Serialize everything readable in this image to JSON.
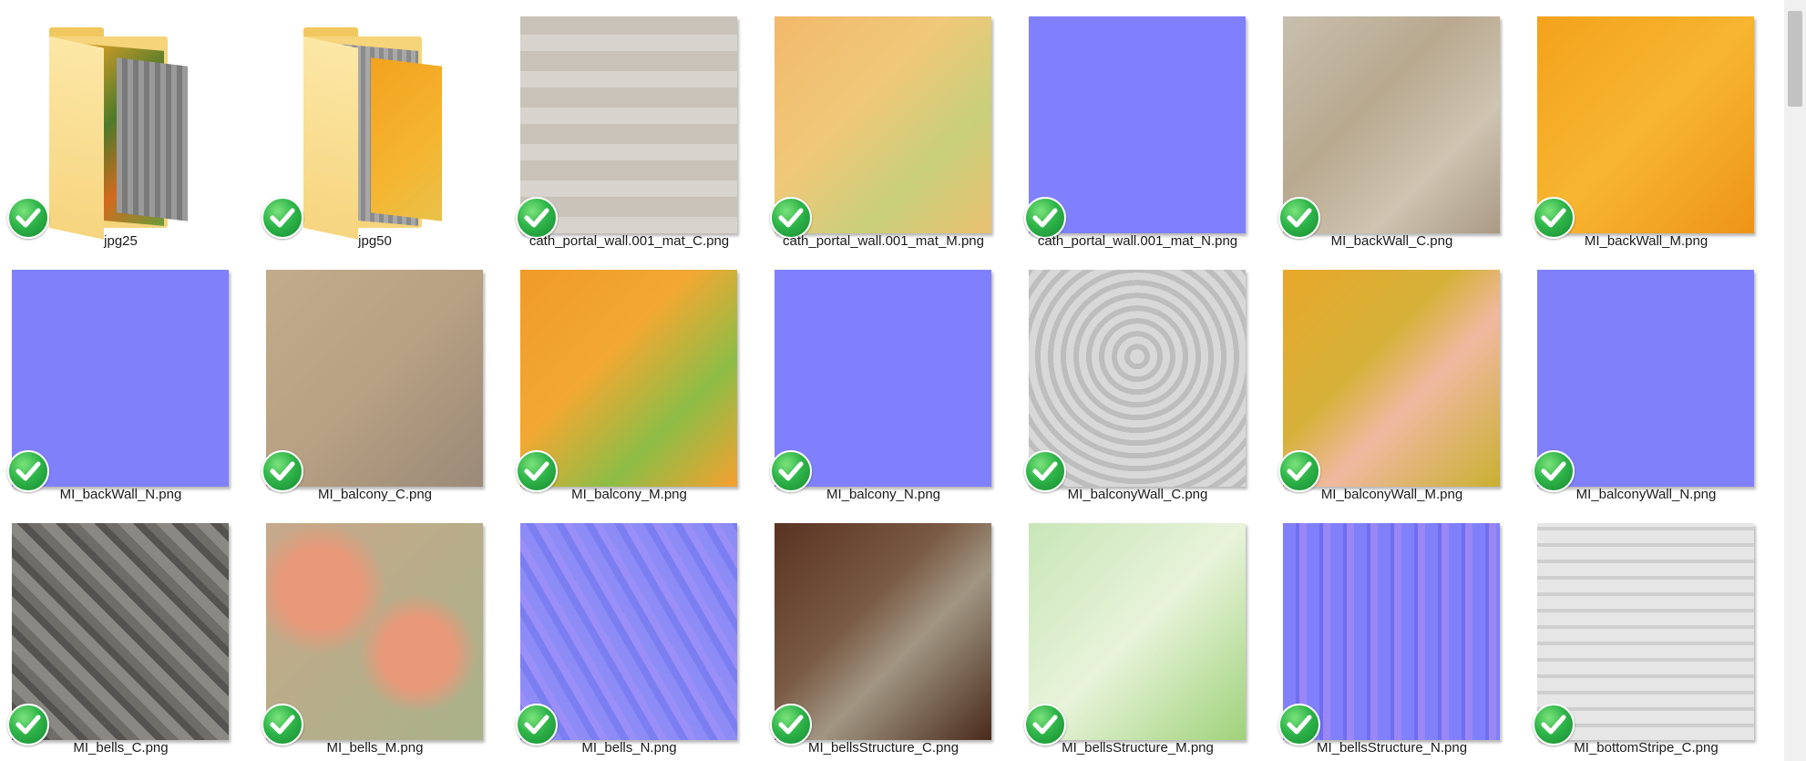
{
  "items": [
    {
      "name": "jpg25",
      "kind": "folder",
      "papers": [
        "linear-gradient(135deg,#e0a028,#4d7a2a 40%,#d26a1e 70%,#6a9b3a)",
        "repeating-linear-gradient(90deg,#9a9a9a 0 6px,#7a7a7a 6px 12px)"
      ]
    },
    {
      "name": "jpg50",
      "kind": "folder",
      "papers": [
        "repeating-linear-gradient(90deg,#a8a8a8 0 5px,#8a8a8a 5px 10px)",
        "linear-gradient(135deg,#f2a21e,#f5b530 60%,#e8c14a)"
      ]
    },
    {
      "name": "cath_portal_wall.001_mat_C.png",
      "kind": "image",
      "bg": "repeating-linear-gradient(0deg,#d8d3cc 0 18px,#c9c2b9 18px 40px),linear-gradient(90deg,#d6d0c7,#bfb7ac)"
    },
    {
      "name": "cath_portal_wall.001_mat_M.png",
      "kind": "image",
      "bg": "linear-gradient(135deg,#f2b96a,#f0c879 40%,#c9cf7a 70%,#e8c070)"
    },
    {
      "name": "cath_portal_wall.001_mat_N.png",
      "kind": "image",
      "bg": "#8080fd"
    },
    {
      "name": "MI_backWall_C.png",
      "kind": "image",
      "bg": "linear-gradient(135deg,#c9bfae,#b8a98f 40%,#cfc4b1 70%,#a99a84)"
    },
    {
      "name": "MI_backWall_M.png",
      "kind": "image",
      "bg": "linear-gradient(135deg,#f4a21c,#f7b530 50%,#ee9418)"
    },
    {
      "name": "MI_backWall_N.png",
      "kind": "image",
      "bg": "#8080fb"
    },
    {
      "name": "MI_balcony_C.png",
      "kind": "image",
      "bg": "linear-gradient(135deg,#c2ab8c,#b8a083 50%,#9a8a78)"
    },
    {
      "name": "MI_balcony_M.png",
      "kind": "image",
      "bg": "linear-gradient(135deg,#f09a2a,#f2a832 40%,#8dbd46 70%,#f5a030)"
    },
    {
      "name": "MI_balcony_N.png",
      "kind": "image",
      "bg": "#8080fd"
    },
    {
      "name": "MI_balconyWall_C.png",
      "kind": "image",
      "bg": "repeating-radial-gradient(circle at 50% 40%,#d8d8d8 0 8px,#bdbdbd 8px 14px)"
    },
    {
      "name": "MI_balconyWall_M.png",
      "kind": "image",
      "bg": "linear-gradient(135deg,#e8a82a,#d6b13a 40%,#f0b8a0 60%,#c9b030)"
    },
    {
      "name": "MI_balconyWall_N.png",
      "kind": "image",
      "bg": "#8080fb"
    },
    {
      "name": "MI_bells_C.png",
      "kind": "image",
      "bg": "repeating-linear-gradient(45deg,#6f6d68 0 10px,#8a8882 10px 22px,#55534f 22px 30px)"
    },
    {
      "name": "MI_bells_M.png",
      "kind": "image",
      "bg": "radial-gradient(circle at 25% 30%,#e8997a 0 18%,transparent 30%),radial-gradient(circle at 70% 60%,#e8997a 0 18%,transparent 30%),linear-gradient(135deg,#c7a88a,#a9b28a)"
    },
    {
      "name": "MI_bells_N.png",
      "kind": "image",
      "bg": "repeating-linear-gradient(60deg,#8d8cf6 0 12px,#7a7ef0 12px 20px,#9a8ff8 20px 28px)"
    },
    {
      "name": "MI_bellsStructure_C.png",
      "kind": "image",
      "bg": "linear-gradient(135deg,#5a3322,#7a5a44 40%,#a19683 60%,#4a2a1c)"
    },
    {
      "name": "MI_bellsStructure_M.png",
      "kind": "image",
      "bg": "linear-gradient(135deg,#c8e6b8,#e8f3da 50%,#9fd27a)"
    },
    {
      "name": "MI_bellsStructure_N.png",
      "kind": "image",
      "bg": "repeating-linear-gradient(90deg,#8080fb 0 14px,#6e6ef0 14px 18px,#9a86f5 18px 26px)"
    },
    {
      "name": "MI_bottomStripe_C.png",
      "kind": "image",
      "bg": "repeating-linear-gradient(0deg,#e6e6e6 0 14px,#cfcfcf 14px 18px)"
    }
  ]
}
